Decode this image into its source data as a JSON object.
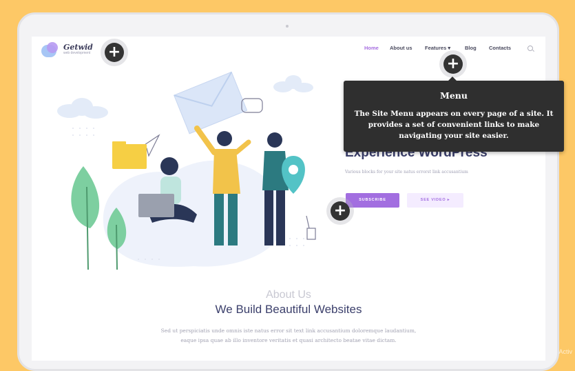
{
  "logo": {
    "name": "Getwid",
    "tagline": "web development"
  },
  "nav": {
    "items": [
      "Home",
      "About us",
      "Features",
      "Blog",
      "Contacts"
    ],
    "active": "Home",
    "features_caret": "▾"
  },
  "tooltip": {
    "title": "Menu",
    "body": "The Site Menu appears on every page of a site. It provides a set of convenient links to make navigating your site easier."
  },
  "hero": {
    "title": "Experience WordPress",
    "subtitle": "Various blocks for your site natus errorst link accusantium",
    "subscribe_label": "SUBSCRIBE",
    "video_label": "SEE VIDEO ▸"
  },
  "about": {
    "kicker": "About Us",
    "heading": "We Build Beautiful Websites",
    "line1": "Sed ut perspiciatis unde omnis iste natus error sit text link accusantium doloremque laudantium,",
    "line2": "eaque ipsa quae ab illo inventore veritatis et quasi architecto beatae vitae dictam."
  },
  "hotspots": {
    "symbol": "+"
  },
  "colors": {
    "background": "#fdc866",
    "accent": "#a26ee0",
    "heading": "#3b3f6b",
    "tooltip": "#2f2f2f"
  },
  "watermark": "Activ"
}
